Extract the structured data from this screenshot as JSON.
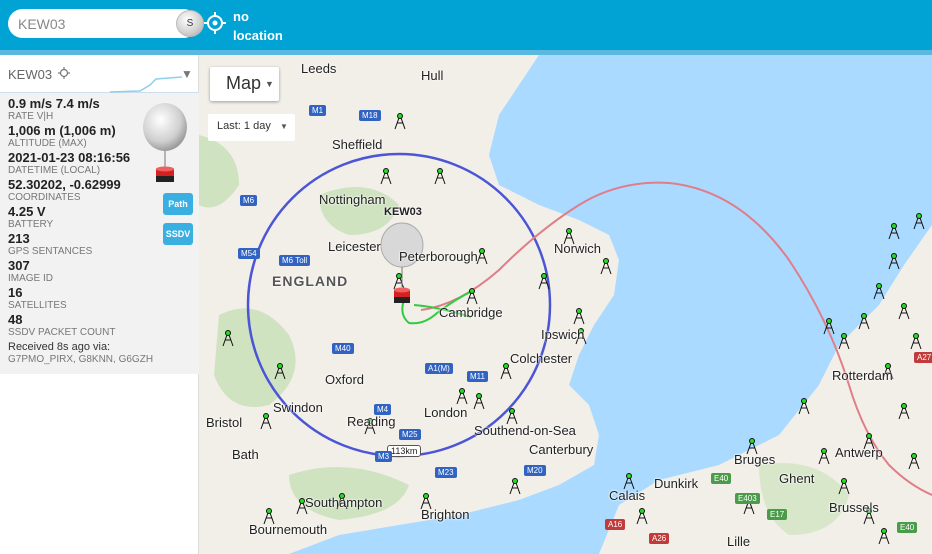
{
  "topbar": {
    "search_value": "KEW03",
    "search_button": "S",
    "location_line1": "no",
    "location_line2": "location"
  },
  "panel": {
    "title": "KEW03",
    "stats": [
      {
        "value": "0.9 m/s 7.4 m/s",
        "key": "RATE V|H"
      },
      {
        "value": "1,006 m (1,006 m)",
        "key": "ALTITUDE (MAX)"
      },
      {
        "value": "2021-01-23 08:16:56",
        "key": "DATETIME (LOCAL)"
      },
      {
        "value": "52.30202, -0.62999",
        "key": "COORDINATES"
      },
      {
        "value": "4.25 V",
        "key": "BATTERY"
      },
      {
        "value": "213",
        "key": "GPS SENTANCES"
      },
      {
        "value": "307",
        "key": "IMAGE ID"
      },
      {
        "value": "16",
        "key": "SATELLITES"
      },
      {
        "value": "48",
        "key": "SSDV PACKET COUNT"
      }
    ],
    "received_line1": "Received 8s ago via:",
    "received_line2": "G7PMO_PIRX, G8KNN, G6GZH",
    "path_button": "Path",
    "ssdv_button": "SSDV"
  },
  "map": {
    "type_label": "Map",
    "time_label": "Last: 1 day",
    "balloon_label": "KEW03",
    "scale_label": "113km",
    "cities": [
      {
        "name": "Leeds"
      },
      {
        "name": "Hull"
      },
      {
        "name": "Sheffield"
      },
      {
        "name": "Nottingham"
      },
      {
        "name": "Leicester"
      },
      {
        "name": "Peterborough"
      },
      {
        "name": "Norwich"
      },
      {
        "name": "ENGLAND"
      },
      {
        "name": "Cambridge"
      },
      {
        "name": "Ipswich"
      },
      {
        "name": "Colchester"
      },
      {
        "name": "Oxford"
      },
      {
        "name": "Swindon"
      },
      {
        "name": "Bristol"
      },
      {
        "name": "Bath"
      },
      {
        "name": "Reading"
      },
      {
        "name": "London"
      },
      {
        "name": "Southend-on-Sea"
      },
      {
        "name": "Canterbury"
      },
      {
        "name": "Brighton"
      },
      {
        "name": "Southampton"
      },
      {
        "name": "Bournemouth"
      },
      {
        "name": "Calais"
      },
      {
        "name": "Dunkirk"
      },
      {
        "name": "Bruges"
      },
      {
        "name": "Ghent"
      },
      {
        "name": "Brussels"
      },
      {
        "name": "Lille"
      },
      {
        "name": "Rotterdam"
      },
      {
        "name": "Antwerp"
      }
    ],
    "roads": [
      {
        "name": "M1"
      },
      {
        "name": "M18"
      },
      {
        "name": "M6"
      },
      {
        "name": "M54"
      },
      {
        "name": "M6 Toll"
      },
      {
        "name": "M40"
      },
      {
        "name": "A1(M)"
      },
      {
        "name": "M11"
      },
      {
        "name": "M4"
      },
      {
        "name": "M25"
      },
      {
        "name": "M23"
      },
      {
        "name": "M20"
      },
      {
        "name": "M3"
      },
      {
        "name": "A16"
      },
      {
        "name": "A26"
      },
      {
        "name": "E40"
      },
      {
        "name": "E17"
      },
      {
        "name": "E403"
      },
      {
        "name": "A27"
      },
      {
        "name": "E40"
      }
    ]
  },
  "colors": {
    "topbar": "#00a3d3",
    "range_circle": "#4b55d6",
    "path_line": "#e07d88",
    "track": "#2ecc40",
    "receiver": "#22dd22"
  }
}
